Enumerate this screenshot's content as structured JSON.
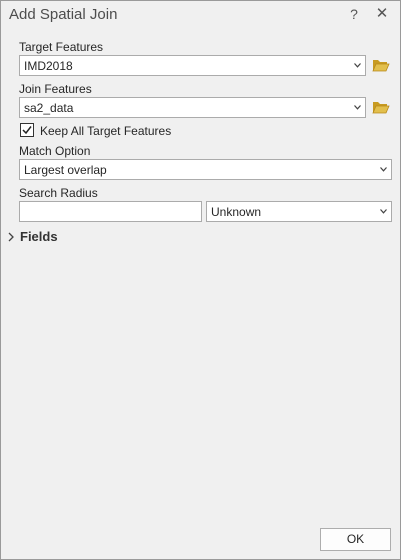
{
  "window": {
    "title": "Add Spatial Join",
    "help": "?",
    "close": "✕"
  },
  "target": {
    "label": "Target Features",
    "value": "IMD2018"
  },
  "join": {
    "label": "Join Features",
    "value": "sa2_data"
  },
  "keep_all": {
    "label": "Keep All Target Features",
    "checked": true
  },
  "match": {
    "label": "Match Option",
    "value": "Largest overlap"
  },
  "search_radius": {
    "label": "Search Radius",
    "value": "",
    "unit": "Unknown"
  },
  "fields_section": {
    "label": "Fields",
    "expanded": false
  },
  "footer": {
    "ok_label": "OK"
  },
  "colors": {
    "folder": "#d9b43a",
    "background": "#f0f0f0",
    "border": "#ababab"
  }
}
